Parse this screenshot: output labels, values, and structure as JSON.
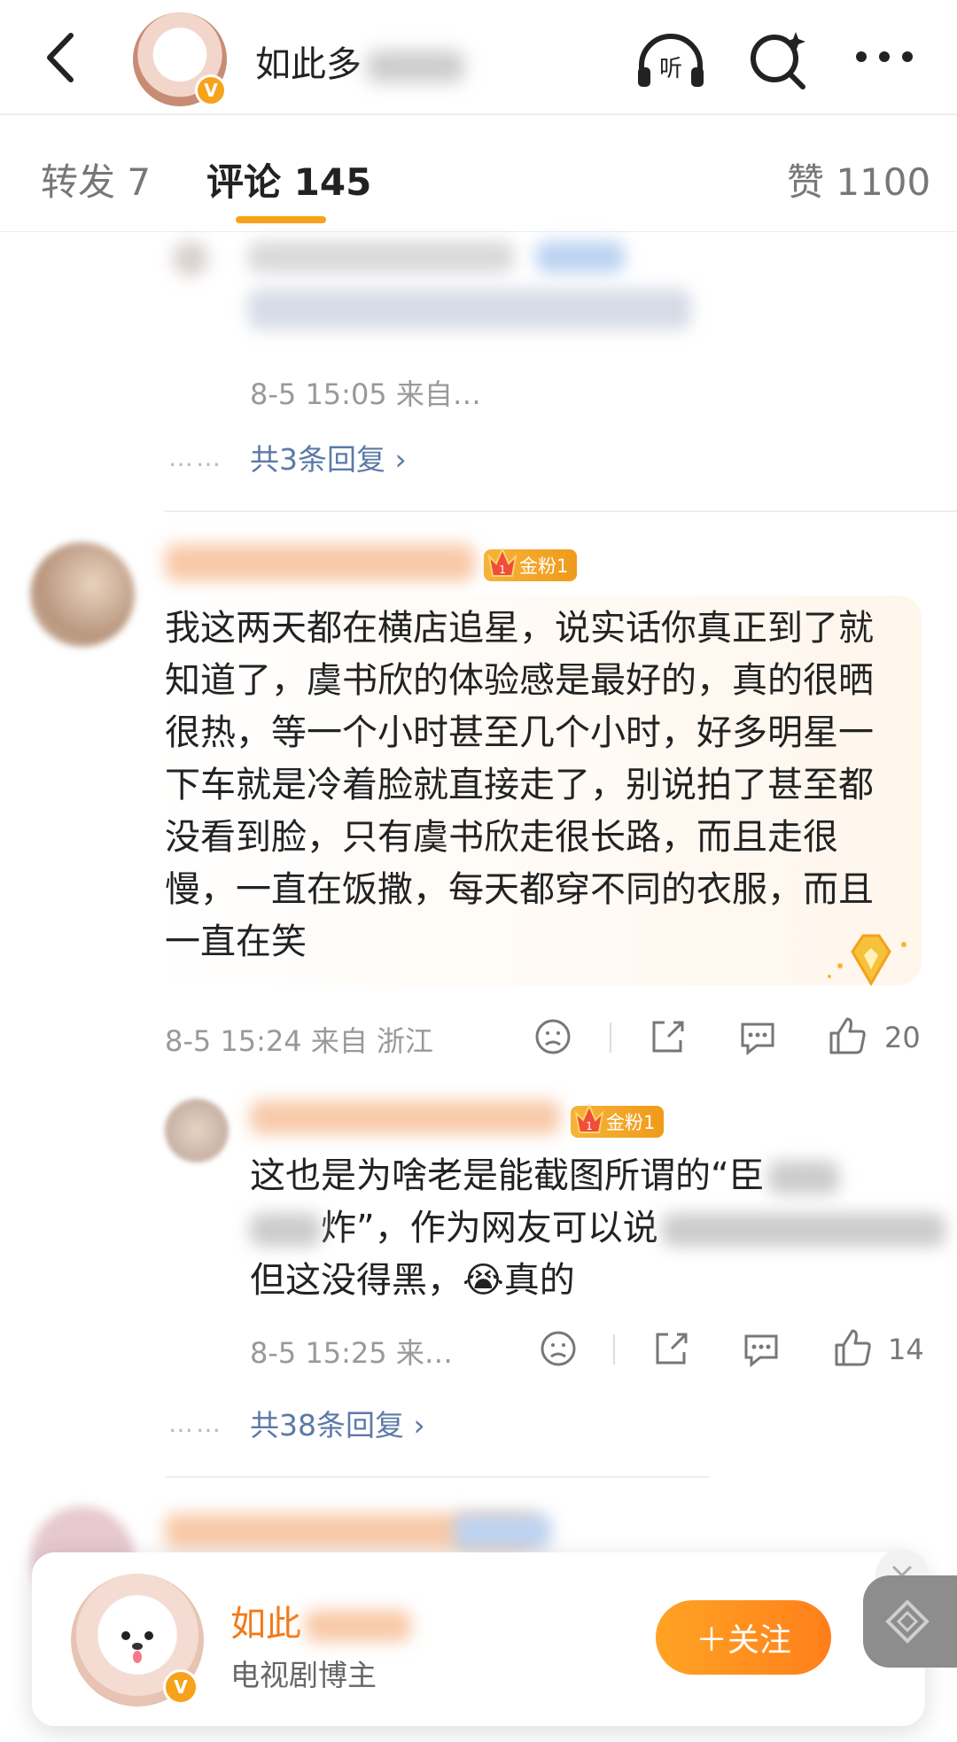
{
  "header": {
    "title": "如此多"
  },
  "tabs": [
    {
      "label": "转发 7"
    },
    {
      "label": "评论 145"
    },
    {
      "label": "赞 1100"
    }
  ],
  "thread1": {
    "reply_time": "8-5 15:05 来自…",
    "more_replies": "共3条回复 ›",
    "dots": "……"
  },
  "comment": {
    "fan_badge": "金粉1",
    "text": "我这两天都在横店追星，说实话你真正到了就知道了，虞书欣的体验感是最好的，真的很晒很热，等一个小时甚至几个小时，好多明星一下车就是冷着脸就直接走了，别说拍了甚至都没看到脸，只有虞书欣走很长路，而且走很慢，一直在饭撒，每天都穿不同的衣服，而且一直在笑",
    "meta": "8-5 15:24 来自 浙江",
    "likes": "20"
  },
  "reply": {
    "fan_badge": "金粉1",
    "line1": "这也是为啥老是能截图所谓的“臣",
    "line2a": "炸”，作为网友可以说",
    "line3": "但这没得黑，😭真的",
    "meta": "8-5 15:25 来…",
    "likes": "14",
    "more_replies": "共38条回复 ›",
    "dots": "……"
  },
  "follow_card": {
    "name": "如此",
    "subtitle": "电视剧博主",
    "follow_label": "＋关注"
  },
  "colors": {
    "accent": "#f7a21b",
    "link": "#5b7aa7",
    "follow_btn": "#ff8a1d"
  }
}
